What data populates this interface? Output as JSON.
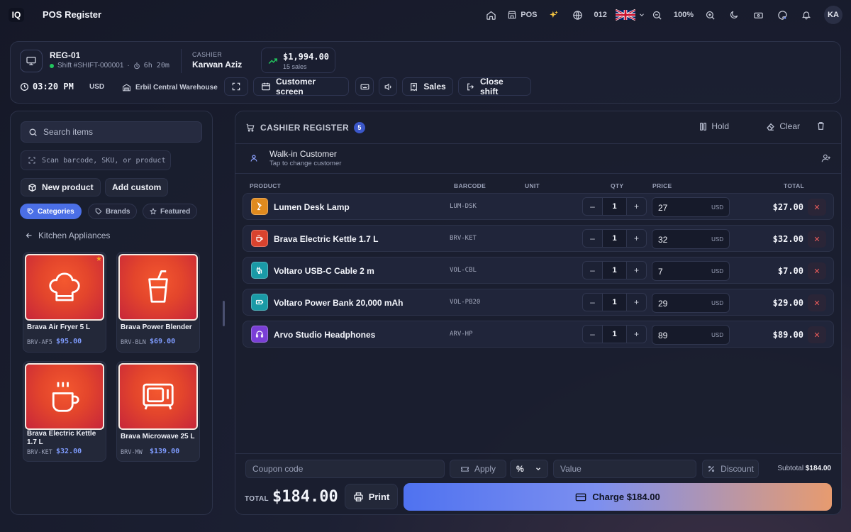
{
  "app": {
    "logo_text": "IQ",
    "title": "POS Register"
  },
  "topbar": {
    "pos_label": "POS",
    "count": "012",
    "zoom": "100%",
    "avatar": "KA"
  },
  "register": {
    "name": "REG-01",
    "shift": "Shift #SHIFT-000001",
    "duration": "6h 20m",
    "cashier_label": "CASHIER",
    "cashier_name": "Karwan Aziz",
    "sales_amount": "$1,994.00",
    "sales_count": "15 sales",
    "time": "03:20 PM",
    "currency": "USD",
    "warehouse": "Erbil Central Warehouse",
    "customer_screen_label": "Customer screen",
    "sales_label": "Sales",
    "close_shift_label": "Close shift"
  },
  "catalog": {
    "search_placeholder": "Search items",
    "scan_placeholder": "Scan barcode, SKU, or product",
    "new_product_label": "New product",
    "add_custom_label": "Add custom",
    "chips": [
      "Categories",
      "Brands",
      "Featured"
    ],
    "active_chip": "Categories",
    "category": "Kitchen Appliances",
    "products": [
      {
        "name": "Brava Air Fryer 5 L",
        "sku": "BRV-AF5",
        "price": "$95.00",
        "icon": "chef-hat-icon",
        "featured": true
      },
      {
        "name": "Brava Power Blender",
        "sku": "BRV-BLN",
        "price": "$69.00",
        "icon": "cup-straw-icon",
        "featured": false
      },
      {
        "name": "Brava Electric Kettle 1.7 L",
        "sku": "BRV-KET",
        "price": "$32.00",
        "icon": "coffee-mug-icon",
        "featured": false
      },
      {
        "name": "Brava Microwave 25 L",
        "sku": "BRV-MW",
        "price": "$139.00",
        "icon": "microwave-icon",
        "featured": false
      }
    ]
  },
  "cart": {
    "title": "CASHIER REGISTER",
    "count": "5",
    "hold_label": "Hold",
    "clear_label": "Clear",
    "customer_name": "Walk-in Customer",
    "customer_hint": "Tap to change customer",
    "columns": {
      "product": "PRODUCT",
      "barcode": "BARCODE",
      "unit": "UNIT",
      "qty": "QTY",
      "price": "PRICE",
      "total": "TOTAL"
    },
    "price_currency": "USD",
    "items": [
      {
        "name": "Lumen Desk Lamp",
        "barcode": "LUM-DSK",
        "qty": "1",
        "price": "27",
        "total": "$27.00",
        "color": "#e08a1e",
        "icon": "lamp-icon"
      },
      {
        "name": "Brava Electric Kettle 1.7 L",
        "barcode": "BRV-KET",
        "qty": "1",
        "price": "32",
        "total": "$32.00",
        "color": "#d9432e",
        "icon": "coffee-mug-icon"
      },
      {
        "name": "Voltaro USB-C Cable 2 m",
        "barcode": "VOL-CBL",
        "qty": "1",
        "price": "7",
        "total": "$7.00",
        "color": "#1a9aa6",
        "icon": "cable-icon"
      },
      {
        "name": "Voltaro Power Bank 20,000 mAh",
        "barcode": "VOL-PB20",
        "qty": "1",
        "price": "29",
        "total": "$29.00",
        "color": "#1a9aa6",
        "icon": "battery-icon"
      },
      {
        "name": "Arvo Studio Headphones",
        "barcode": "ARV-HP",
        "qty": "1",
        "price": "89",
        "total": "$89.00",
        "color": "#7a3fd6",
        "icon": "headphones-icon"
      }
    ],
    "coupon_placeholder": "Coupon code",
    "apply_label": "Apply",
    "discount_type": "%",
    "value_placeholder": "Value",
    "discount_label": "Discount",
    "subtotal_label": "Subtotal",
    "subtotal": "$184.00",
    "total_label": "TOTAL",
    "total": "$184.00",
    "print_label": "Print",
    "charge_label": "Charge $184.00"
  },
  "colors": {
    "accent": "#4b6fe6",
    "danger": "#e85b5b",
    "price": "#7f9cff",
    "success": "#22c55e"
  }
}
